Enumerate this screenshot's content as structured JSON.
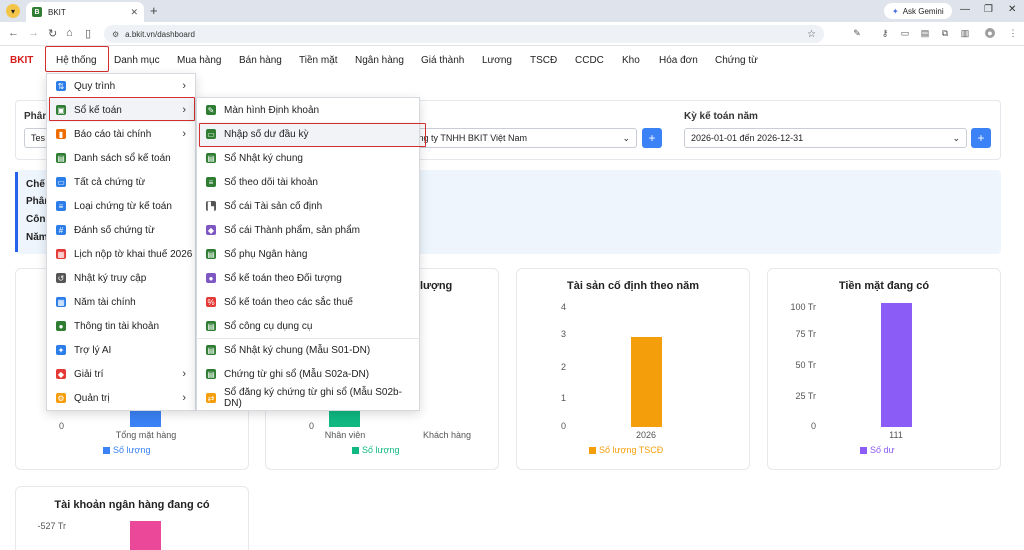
{
  "browser": {
    "tab_title": "BKIT",
    "url": "a.bkit.vn/dashboard",
    "gemini_label": "Ask Gemini"
  },
  "app": {
    "logo": "BKIT",
    "nav": [
      "Hệ thống",
      "Danh mục",
      "Mua hàng",
      "Bán hàng",
      "Tiền mặt",
      "Ngân hàng",
      "Giá thành",
      "Lương",
      "TSCĐ",
      "CCDC",
      "Kho",
      "Hóa đơn",
      "Chứng từ"
    ]
  },
  "filters": {
    "label1": "Phân",
    "select1_value": "Tes",
    "select2_value": "Công ty TNHH BKIT Việt Nam",
    "period_label": "Kỳ kế toán năm",
    "period_value": "2026-01-01 đến 2026-12-31",
    "plus": "+"
  },
  "info_labels": [
    "Chế",
    "Phân",
    "Công",
    "Năm"
  ],
  "cards": {
    "card1": {
      "xlabel": "Tổng mặt hàng",
      "legend": "Số lượng",
      "axis0": "0"
    },
    "card2": {
      "title_tail": "lượng",
      "xlabel1": "Nhân viên",
      "xlabel2": "Khách hàng",
      "legend": "Số lượng",
      "axis0": "0"
    },
    "card3": {
      "title": "Tài sản cố định theo năm",
      "ticks": [
        "4",
        "3",
        "2",
        "1",
        "0"
      ],
      "xlabel": "2026",
      "legend": "Số lượng TSCĐ"
    },
    "card4": {
      "title": "Tiền mặt đang có",
      "ticks": [
        "100 Tr",
        "75 Tr",
        "50 Tr",
        "25 Tr",
        "0"
      ],
      "xlabel": "111",
      "legend": "Số dư"
    },
    "card5": {
      "title": "Tài khoản ngân hàng đang có",
      "tick": "-527 Tr"
    }
  },
  "chart_data": [
    {
      "type": "bar",
      "title": "Tài sản cố định theo năm",
      "categories": [
        "2026"
      ],
      "series": [
        {
          "name": "Số lượng TSCĐ",
          "values": [
            3
          ]
        }
      ],
      "ylim": [
        0,
        4
      ],
      "color": "#f59e0b"
    },
    {
      "type": "bar",
      "title": "Tiền mặt đang có",
      "categories": [
        "111"
      ],
      "series": [
        {
          "name": "Số dư",
          "values": [
            103
          ]
        }
      ],
      "ylabel_unit": "Tr",
      "ylim": [
        0,
        100
      ],
      "color": "#8b5cf6"
    }
  ],
  "menu1": [
    {
      "label": "Quy trình",
      "icon": "workflow-icon",
      "color": "#2b7de9",
      "chevron": true
    },
    {
      "label": "Sổ kế toán",
      "icon": "ledger-book-icon",
      "color": "#2e7d32",
      "chevron": true,
      "active": true
    },
    {
      "label": "Báo cáo tài chính",
      "icon": "bar-chart-icon",
      "color": "#ef6c00",
      "chevron": true
    },
    {
      "label": "Danh sách sổ kế toán",
      "icon": "book-icon",
      "color": "#2e7d32"
    },
    {
      "label": "Tất cả chứng từ",
      "icon": "document-icon",
      "color": "#2b7de9"
    },
    {
      "label": "Loại chứng từ kế toán",
      "icon": "list-icon",
      "color": "#2b7de9"
    },
    {
      "label": "Đánh số chứng từ",
      "icon": "numbering-icon",
      "color": "#2b7de9"
    },
    {
      "label": "Lịch nộp tờ khai thuế 2026",
      "icon": "calendar-icon",
      "color": "#e53935"
    },
    {
      "label": "Nhật ký truy cập",
      "icon": "history-icon",
      "color": "#555555"
    },
    {
      "label": "Năm tài chính",
      "icon": "calendar-year-icon",
      "color": "#2b7de9"
    },
    {
      "label": "Thông tin tài khoản",
      "icon": "account-icon",
      "color": "#2e7d32"
    },
    {
      "label": "Trợ lý AI",
      "icon": "ai-assistant-icon",
      "color": "#2b7de9"
    },
    {
      "label": "Giải trí",
      "icon": "gamepad-icon",
      "color": "#e53935",
      "chevron": true
    },
    {
      "label": "Quản trị",
      "icon": "admin-icon",
      "color": "#f59e0b",
      "chevron": true
    }
  ],
  "menu2": [
    {
      "label": "Màn hình Định khoản",
      "icon": "journal-entry-icon",
      "color": "#2e7d32"
    },
    {
      "label": "Nhập số dư đầu kỳ",
      "icon": "opening-balance-icon",
      "color": "#2e7d32",
      "active": true
    },
    {
      "label": "Sổ Nhật ký chung",
      "icon": "book-icon",
      "color": "#2e7d32"
    },
    {
      "label": "Sổ theo dõi tài khoản",
      "icon": "list-icon",
      "color": "#2e7d32"
    },
    {
      "label": "Sổ cái Tài sản cố định",
      "icon": "building-icon",
      "color": "#555555"
    },
    {
      "label": "Sổ cái Thành phẩm, sản phẩm",
      "icon": "product-icon",
      "color": "#7e57c2"
    },
    {
      "label": "Sổ phụ Ngân hàng",
      "icon": "bank-icon",
      "color": "#2e7d32"
    },
    {
      "label": "Sổ kế toán theo Đối tượng",
      "icon": "people-icon",
      "color": "#7e57c2"
    },
    {
      "label": "Sổ kế toán theo các sắc thuế",
      "icon": "tax-icon",
      "color": "#e53935"
    },
    {
      "label": "Sổ công cụ dụng cụ",
      "icon": "tools-book-icon",
      "color": "#2e7d32"
    },
    {
      "label": "Sổ Nhật ký chung (Mẫu S01-DN)",
      "icon": "book-icon",
      "color": "#2e7d32"
    },
    {
      "label": "Chứng từ ghi sổ (Mẫu S02a-DN)",
      "icon": "voucher-icon",
      "color": "#2e7d32"
    },
    {
      "label": "Sổ đăng ký chứng từ ghi sổ (Mẫu S02b-DN)",
      "icon": "register-icon",
      "color": "#f59e0b"
    }
  ]
}
